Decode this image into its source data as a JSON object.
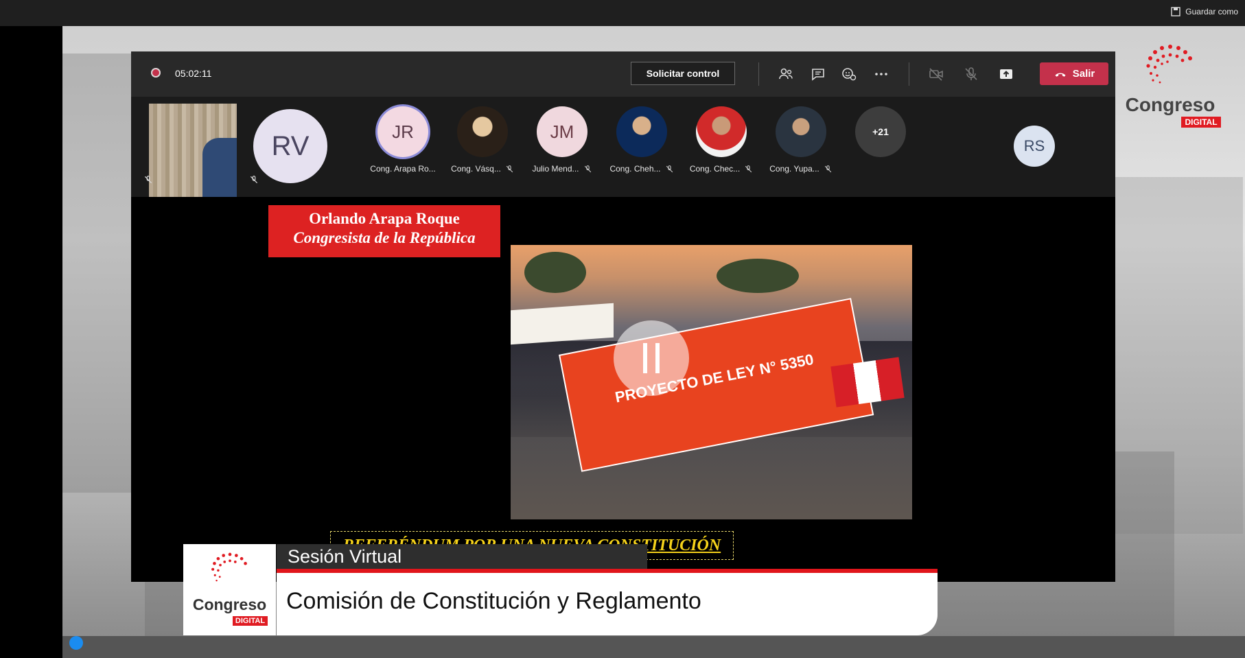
{
  "window": {
    "save_as_label": "Guardar como"
  },
  "meeting": {
    "timer": "05:02:11",
    "request_control_label": "Solicitar control",
    "leave_label": "Salir",
    "icons": [
      "participants-icon",
      "chat-icon",
      "reactions-icon",
      "more-options-icon",
      "camera-off-icon",
      "mic-off-icon",
      "share-icon",
      "phone-hangup-icon"
    ]
  },
  "participants": {
    "big_avatar_initials": "RV",
    "list": [
      {
        "initials": "JR",
        "name": "Cong. Arapa Ro..."
      },
      {
        "initials": "",
        "name": "Cong. Vásq..."
      },
      {
        "initials": "JM",
        "name": "Julio Mend..."
      },
      {
        "initials": "",
        "name": "Cong. Cheh..."
      },
      {
        "initials": "",
        "name": "Cong. Chec..."
      },
      {
        "initials": "",
        "name": "Cong. Yupa..."
      }
    ],
    "overflow_count": "+21",
    "right_avatar_initials": "RS"
  },
  "shared_content": {
    "name_card_line1": "Orlando Arapa Roque",
    "name_card_line2": "Congresista de la República",
    "banner_text": "PROYECTO DE LEY N° 5350",
    "caption": "REFERÉNDUM POR UNA NUEVA CONSTITUCIÓN"
  },
  "branding": {
    "logo_word": "Congreso",
    "logo_tag": "DIGITAL",
    "accent_red": "#e01b22"
  },
  "lower_third": {
    "session_label": "Sesión Virtual",
    "title": "Comisión de Constitución y Reglamento"
  }
}
